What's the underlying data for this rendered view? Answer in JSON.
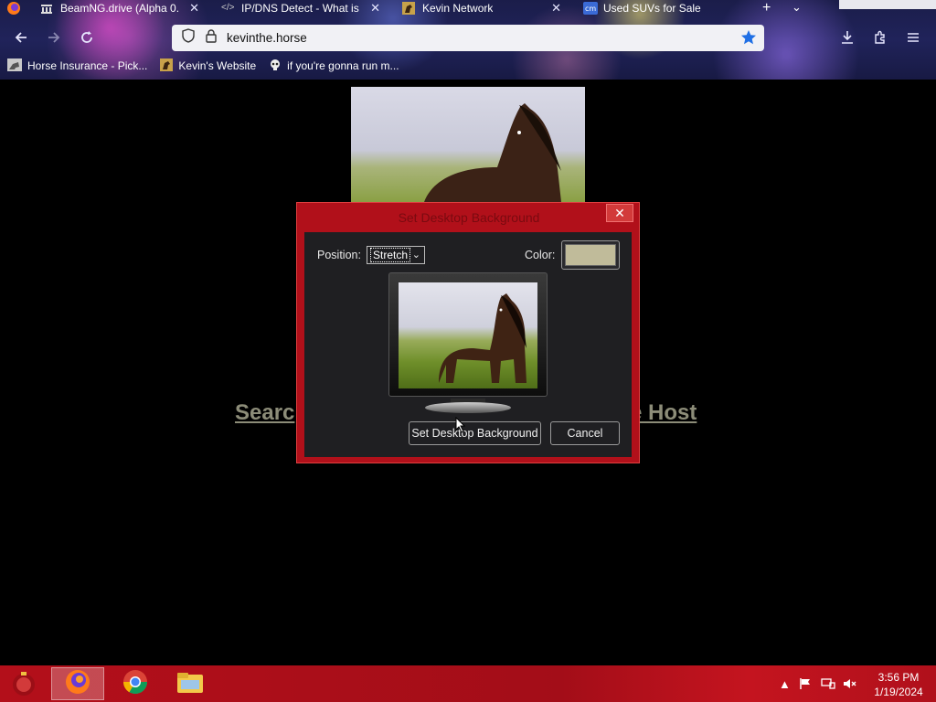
{
  "browser": {
    "tabs": [
      {
        "title": "BeamNG.drive (Alpha 0.",
        "icon": "museum-icon"
      },
      {
        "title": "IP/DNS Detect - What is",
        "icon": "code-icon"
      },
      {
        "title": "Kevin Network",
        "icon": "horse-icon"
      },
      {
        "title": "Used SUVs for Sale",
        "icon": "cars-icon"
      }
    ],
    "url": "kevinthe.horse",
    "bookmarks": [
      {
        "label": "Horse Insurance - Pick...",
        "icon": "horse-photo-icon"
      },
      {
        "label": "Kevin's Website",
        "icon": "horse-icon"
      },
      {
        "label": "if you're gonna run m...",
        "icon": "skull-icon"
      }
    ]
  },
  "page": {
    "link_left": "Searc",
    "link_right": "e Host"
  },
  "dialog": {
    "title": "Set Desktop Background",
    "close": "✕",
    "position_label": "Position:",
    "position_value": "Stretch",
    "color_label": "Color:",
    "swatch_color": "#c0bb9a",
    "set_button": "Set Desktop Background",
    "cancel_button": "Cancel"
  },
  "taskbar": {
    "time": "3:56 PM",
    "date": "1/19/2024",
    "pinned": [
      "firefox-icon",
      "chrome-icon",
      "file-explorer-icon"
    ]
  },
  "colors": {
    "dialog_frame": "#b1101a",
    "taskbar": "#b30f1a",
    "link": "#8c8c78"
  }
}
